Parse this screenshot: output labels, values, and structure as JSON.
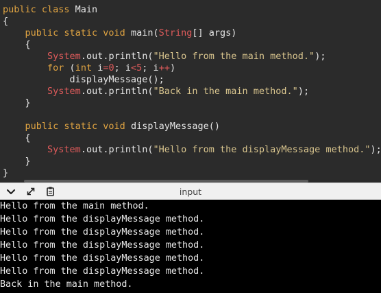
{
  "editor": {
    "lines": [
      {
        "tokens": [
          {
            "t": "public class ",
            "c": "kw"
          },
          {
            "t": "Main",
            "c": "plain"
          }
        ]
      },
      {
        "tokens": [
          {
            "t": "{",
            "c": "plain"
          }
        ]
      },
      {
        "tokens": [
          {
            "t": "    public static void ",
            "c": "kw"
          },
          {
            "t": "main(",
            "c": "plain"
          },
          {
            "t": "String",
            "c": "cls"
          },
          {
            "t": "[] args)",
            "c": "plain"
          }
        ]
      },
      {
        "tokens": [
          {
            "t": "    {",
            "c": "plain"
          }
        ]
      },
      {
        "tokens": [
          {
            "t": "        ",
            "c": "plain"
          },
          {
            "t": "System",
            "c": "cls"
          },
          {
            "t": ".out.println(",
            "c": "plain"
          },
          {
            "t": "\"Hello from the main method.\"",
            "c": "str"
          },
          {
            "t": ");",
            "c": "plain"
          }
        ]
      },
      {
        "tokens": [
          {
            "t": "        ",
            "c": "plain"
          },
          {
            "t": "for",
            "c": "kw"
          },
          {
            "t": " (",
            "c": "plain"
          },
          {
            "t": "int",
            "c": "kw"
          },
          {
            "t": " i",
            "c": "plain"
          },
          {
            "t": "=",
            "c": "op"
          },
          {
            "t": "0",
            "c": "num"
          },
          {
            "t": "; i",
            "c": "plain"
          },
          {
            "t": "<",
            "c": "op"
          },
          {
            "t": "5",
            "c": "num"
          },
          {
            "t": "; i",
            "c": "plain"
          },
          {
            "t": "++",
            "c": "op"
          },
          {
            "t": ")",
            "c": "plain"
          }
        ]
      },
      {
        "tokens": [
          {
            "t": "            displayMessage();",
            "c": "plain"
          }
        ]
      },
      {
        "tokens": [
          {
            "t": "        ",
            "c": "plain"
          },
          {
            "t": "System",
            "c": "cls"
          },
          {
            "t": ".out.println(",
            "c": "plain"
          },
          {
            "t": "\"Back in the main method.\"",
            "c": "str"
          },
          {
            "t": ");",
            "c": "plain"
          }
        ]
      },
      {
        "tokens": [
          {
            "t": "    }",
            "c": "plain"
          }
        ]
      },
      {
        "tokens": []
      },
      {
        "tokens": [
          {
            "t": "    public static void ",
            "c": "kw"
          },
          {
            "t": "displayMessage()",
            "c": "plain"
          }
        ]
      },
      {
        "tokens": [
          {
            "t": "    {",
            "c": "plain"
          }
        ]
      },
      {
        "tokens": [
          {
            "t": "        ",
            "c": "plain"
          },
          {
            "t": "System",
            "c": "cls"
          },
          {
            "t": ".out.println(",
            "c": "plain"
          },
          {
            "t": "\"Hello from the displayMessage method.\"",
            "c": "str"
          },
          {
            "t": ");",
            "c": "plain"
          }
        ]
      },
      {
        "tokens": [
          {
            "t": "    }",
            "c": "plain"
          }
        ]
      },
      {
        "tokens": [
          {
            "t": "}",
            "c": "plain"
          }
        ]
      }
    ]
  },
  "panel": {
    "title": "input",
    "icons": [
      "chevron-down-icon",
      "expand-icon",
      "clipboard-icon"
    ]
  },
  "console": {
    "lines": [
      "Hello from the main method.",
      "Hello from the displayMessage method.",
      "Hello from the displayMessage method.",
      "Hello from the displayMessage method.",
      "Hello from the displayMessage method.",
      "Hello from the displayMessage method.",
      "Back in the main method."
    ]
  },
  "colors": {
    "editor_bg": "#2b2b2b",
    "keyword": "#e0a442",
    "class_name": "#e05b5b",
    "string": "#d9c58e",
    "console_bg": "#000000",
    "console_fg": "#e8e8e8"
  }
}
